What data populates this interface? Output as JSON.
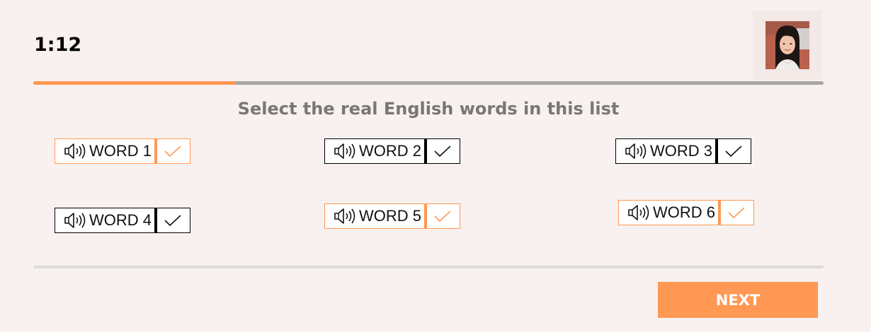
{
  "timer": "1:12",
  "progress": {
    "fraction": 0.256,
    "fill_color": "#ff9852",
    "track_color": "#a7a7a5"
  },
  "question": "Select the real English words in this list",
  "words": [
    {
      "label": "WORD 1",
      "selected": true
    },
    {
      "label": "WORD 2",
      "selected": false
    },
    {
      "label": "WORD 3",
      "selected": false
    },
    {
      "label": "WORD 4",
      "selected": false
    },
    {
      "label": "WORD 5",
      "selected": true
    },
    {
      "label": "WORD 6",
      "selected": true
    }
  ],
  "next_label": "NEXT",
  "colors": {
    "accent": "#ff9852",
    "background": "#f8f1f0",
    "question_text": "#777775"
  }
}
